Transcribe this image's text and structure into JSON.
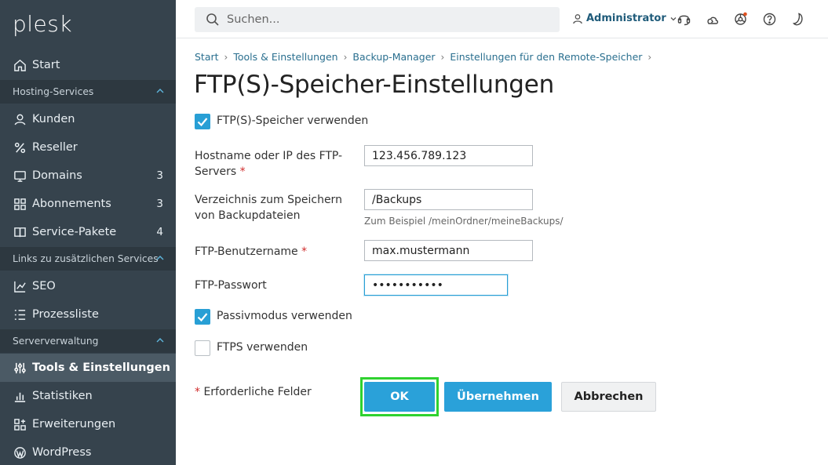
{
  "sidebar": {
    "logo": "plesk",
    "start": "Start",
    "sections": {
      "hosting": "Hosting-Services",
      "links": "Links zu zusätzlichen Services",
      "server": "Serververwaltung"
    },
    "hosting_items": [
      {
        "label": "Kunden",
        "icon": "user-icon",
        "count": ""
      },
      {
        "label": "Reseller",
        "icon": "percent-icon",
        "count": ""
      },
      {
        "label": "Domains",
        "icon": "monitor-icon",
        "count": "3"
      },
      {
        "label": "Abonnements",
        "icon": "grid-icon",
        "count": "3"
      },
      {
        "label": "Service-Pakete",
        "icon": "book-icon",
        "count": "4"
      }
    ],
    "link_items": [
      {
        "label": "SEO",
        "icon": "chart-icon"
      },
      {
        "label": "Prozessliste",
        "icon": "list-icon"
      }
    ],
    "server_items": [
      {
        "label": "Tools & Einstellungen",
        "icon": "sliders-icon",
        "active": true
      },
      {
        "label": "Statistiken",
        "icon": "bar-chart-icon"
      },
      {
        "label": "Erweiterungen",
        "icon": "extensions-icon"
      },
      {
        "label": "WordPress",
        "icon": "wordpress-icon"
      }
    ]
  },
  "topbar": {
    "search_placeholder": "Suchen...",
    "user": "Administrator"
  },
  "breadcrumb": [
    "Start",
    "Tools & Einstellungen",
    "Backup-Manager",
    "Einstellungen für den Remote-Speicher"
  ],
  "page_title": "FTP(S)-Speicher-Einstellungen",
  "form": {
    "use_ftp_label": "FTP(S)-Speicher verwenden",
    "use_ftp_checked": true,
    "hostname_label": "Hostname oder IP des FTP-Servers",
    "hostname_value": "123.456.789.123",
    "directory_label": "Verzeichnis zum Speichern von Backupdateien",
    "directory_value": "/Backups",
    "directory_hint": "Zum Beispiel /meinOrdner/meineBackups/",
    "username_label": "FTP-Benutzername",
    "username_value": "max.mustermann",
    "password_label": "FTP-Passwort",
    "password_value": "•••••••••••",
    "passive_label": "Passivmodus verwenden",
    "passive_checked": true,
    "ftps_label": "FTPS verwenden",
    "ftps_checked": false,
    "required_note": "Erforderliche Felder",
    "required_mark": "*"
  },
  "buttons": {
    "ok": "OK",
    "apply": "Übernehmen",
    "cancel": "Abbrechen"
  },
  "colors": {
    "sidebar_bg": "#36434d",
    "accent": "#2aa1d9",
    "highlight": "#2fd22f",
    "required": "#d02c2c"
  }
}
